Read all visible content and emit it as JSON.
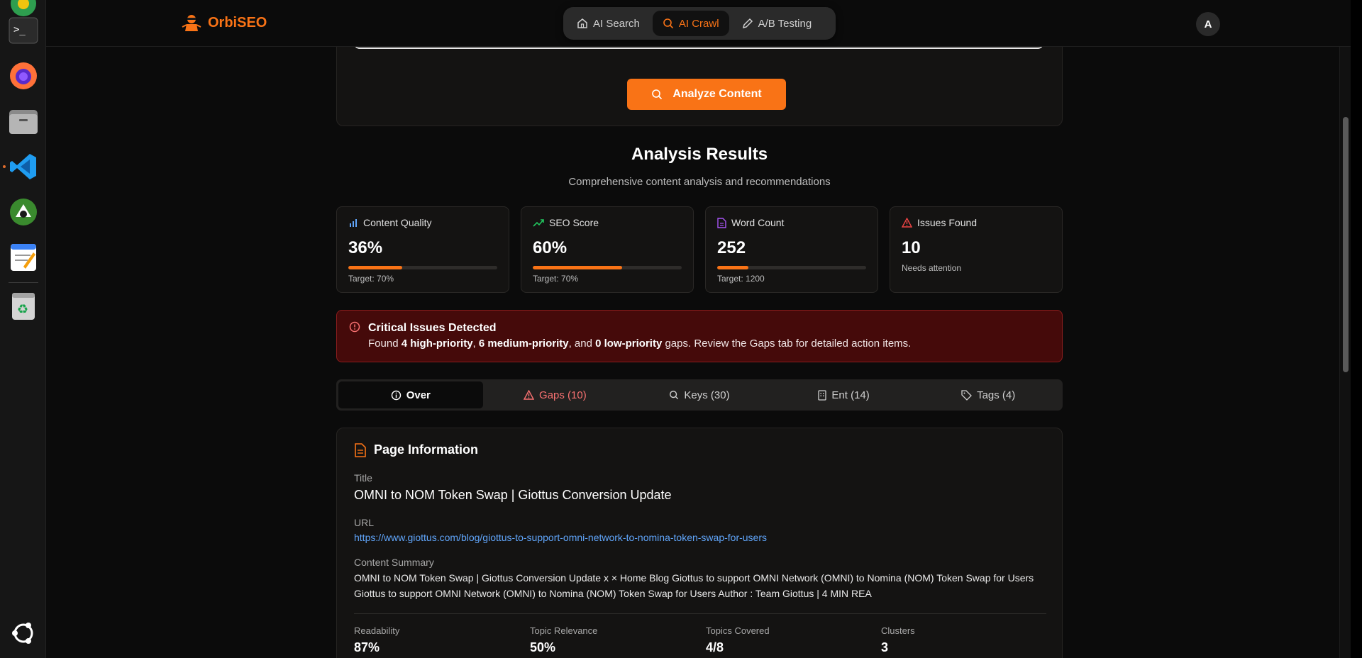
{
  "brand": {
    "name": "OrbiSEO"
  },
  "nav": {
    "items": [
      {
        "label": "AI Search",
        "icon": "home-icon",
        "active": false
      },
      {
        "label": "AI Crawl",
        "icon": "search-icon",
        "active": true
      },
      {
        "label": "A/B Testing",
        "icon": "pencil-icon",
        "active": false
      }
    ]
  },
  "user": {
    "avatar_initial": "A"
  },
  "analyze": {
    "button_label": "Analyze Content"
  },
  "results": {
    "title": "Analysis Results",
    "subtitle": "Comprehensive content analysis and recommendations"
  },
  "stats": {
    "quality": {
      "label": "Content Quality",
      "value": "36%",
      "progress": 0.36,
      "target": "Target: 70%"
    },
    "seo": {
      "label": "SEO Score",
      "value": "60%",
      "progress": 0.6,
      "target": "Target: 70%"
    },
    "words": {
      "label": "Word Count",
      "value": "252",
      "progress": 0.21,
      "target": "Target: 1200"
    },
    "issues": {
      "label": "Issues Found",
      "value": "10",
      "note": "Needs attention"
    }
  },
  "alert": {
    "title": "Critical Issues Detected",
    "prefix": "Found ",
    "high": "4 high-priority",
    "sep1": ", ",
    "medium": "6 medium-priority",
    "sep2": ", and ",
    "low": "0 low-priority",
    "suffix": " gaps. Review the Gaps tab for detailed action items."
  },
  "tabs": {
    "over": "Over",
    "gaps": "Gaps (10)",
    "keys": "Keys (30)",
    "ent": "Ent (14)",
    "tags": "Tags (4)"
  },
  "page_info": {
    "heading": "Page Information",
    "title_label": "Title",
    "title_value": "OMNI to NOM Token Swap | Giottus Conversion Update",
    "url_label": "URL",
    "url_value": "https://www.giottus.com/blog/giottus-to-support-omni-network-to-nomina-token-swap-for-users",
    "summary_label": "Content Summary",
    "summary_value": "OMNI to NOM Token Swap | Giottus Conversion Update x × Home Blog Giottus to support OMNI Network (OMNI) to Nomina (NOM) Token Swap for Users Giottus to support OMNI Network (OMNI) to Nomina (NOM) Token Swap for Users Author : Team Giottus | 4 MIN REA",
    "metrics": [
      {
        "label": "Readability",
        "value": "87%"
      },
      {
        "label": "Topic Relevance",
        "value": "50%"
      },
      {
        "label": "Topics Covered",
        "value": "4/8"
      },
      {
        "label": "Clusters",
        "value": "3"
      }
    ]
  },
  "colors": {
    "accent": "#f97316",
    "danger_bg": "#450a0a",
    "link": "#60a5fa"
  }
}
